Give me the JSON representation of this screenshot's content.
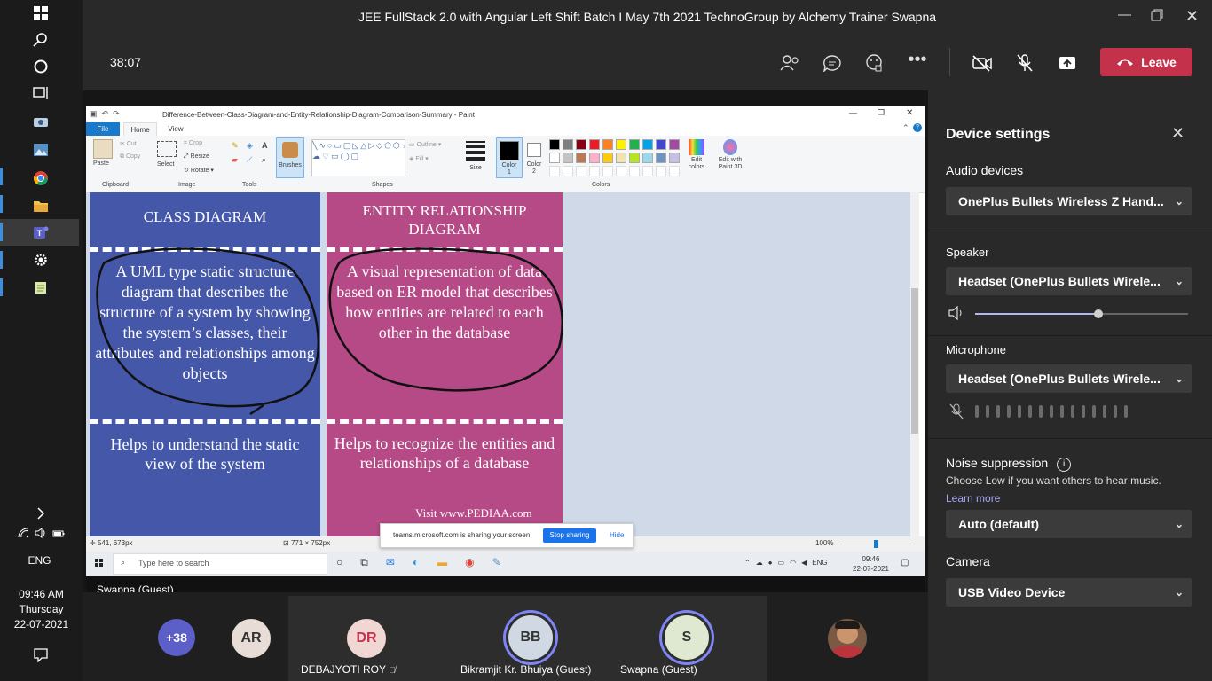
{
  "window": {
    "title": "JEE FullStack 2.0 with Angular Left Shift Batch I May 7th 2021 TechnoGroup by Alchemy Trainer Swapna",
    "minimize_icon": "minimize-icon",
    "maximize_icon": "maximize-icon",
    "close_icon": "close-icon"
  },
  "taskbar": {
    "lang": "ENG",
    "time": "09:46 AM",
    "day": "Thursday",
    "date": "22-07-2021",
    "icons": [
      "windows-start-icon",
      "search-icon",
      "cortana-icon",
      "task-view-icon",
      "camera-icon",
      "photos-icon",
      "chrome-icon",
      "file-explorer-icon",
      "teams-icon",
      "settings-icon",
      "notepad-icon"
    ]
  },
  "meeting": {
    "timer": "38:07",
    "leave_label": "Leave",
    "accent": "#c4314b"
  },
  "paint": {
    "title": "Difference-Between-Class-Diagram-and-Entity-Relationship-Diagram-Comparison-Summary - Paint",
    "tabs": [
      "File",
      "Home",
      "View"
    ],
    "clipboard": {
      "paste": "Paste",
      "cut": "Cut",
      "copy": "Copy",
      "group": "Clipboard"
    },
    "image": {
      "select": "Select",
      "crop": "Crop",
      "resize": "Resize",
      "rotate": "Rotate",
      "group": "Image"
    },
    "tools_group": "Tools",
    "brushes": "Brushes",
    "shapes": {
      "outline": "Outline",
      "fill": "Fill",
      "group": "Shapes"
    },
    "size": "Size",
    "color1": "Color\n1",
    "color2": "Color\n2",
    "edit_colors": "Edit colors",
    "edit_paint3d": "Edit with Paint 3D",
    "colors_group": "Colors",
    "palette": [
      "#000000",
      "#7f7f7f",
      "#880015",
      "#ed1c24",
      "#ff7f27",
      "#fff200",
      "#22b14c",
      "#00a2e8",
      "#3f48cc",
      "#a349a4",
      "#ffffff",
      "#c3c3c3",
      "#b97a57",
      "#ffaec9",
      "#ffc90e",
      "#efe4b0",
      "#b5e61d",
      "#99d9ea",
      "#7092be",
      "#c8bfe7"
    ],
    "status": {
      "pos": "541, 673px",
      "size": "771 × 752px",
      "zoom": "100%"
    },
    "class_panel": {
      "heading": "CLASS DIAGRAM",
      "desc": "A UML type static structure diagram that describes the structure of a system by showing the system’s classes, their attributes and relationships among objects",
      "foot": "Helps to understand the static view of the system"
    },
    "er_panel": {
      "heading": "ENTITY RELATIONSHIP DIAGRAM",
      "desc": "A visual representation of data based on ER model that describes how entities are related to each other in the database",
      "foot": "Helps to recognize the entities and relationships of a database",
      "credit": "Visit www.PEDIAA.com"
    },
    "share_note": {
      "text": "teams.microsoft.com is sharing your screen.",
      "stop": "Stop sharing",
      "hide": "Hide"
    },
    "win_search": "Type here to search",
    "win_lang": "ENG",
    "win_time": "09:46",
    "win_date": "22-07-2021"
  },
  "presenter_name": "Swapna (Guest)",
  "participants": {
    "more": "+38",
    "tiles": [
      {
        "initials": "AR",
        "name": ""
      },
      {
        "initials": "DR",
        "name": "DEBAJYOTI ROY"
      },
      {
        "initials": "BB",
        "name": "Bikramjit Kr. Bhuiya (Guest)"
      },
      {
        "initials": "S",
        "name": "Swapna (Guest)"
      }
    ]
  },
  "settings": {
    "title": "Device settings",
    "audio_devices_label": "Audio devices",
    "audio_device": "OnePlus Bullets Wireless Z Hand...",
    "speaker_label": "Speaker",
    "speaker": "Headset (OnePlus Bullets Wirele...",
    "speaker_volume": 0.58,
    "microphone_label": "Microphone",
    "microphone": "Headset (OnePlus Bullets Wirele...",
    "noise_label": "Noise suppression",
    "noise_hint": "Choose Low if you want others to hear music.",
    "learn_more": "Learn more",
    "noise_value": "Auto (default)",
    "camera_label": "Camera",
    "camera": "USB Video Device"
  }
}
